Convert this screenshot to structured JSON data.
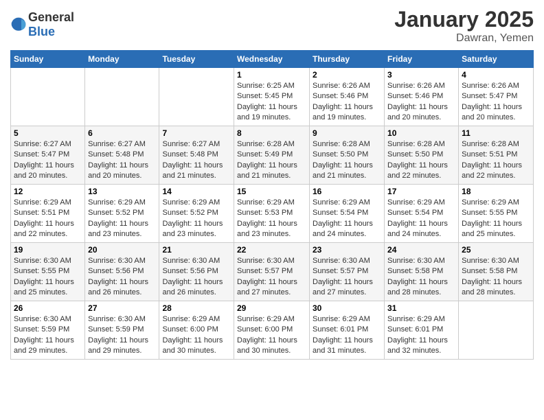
{
  "header": {
    "logo_general": "General",
    "logo_blue": "Blue",
    "month_title": "January 2025",
    "location": "Dawran, Yemen"
  },
  "days_of_week": [
    "Sunday",
    "Monday",
    "Tuesday",
    "Wednesday",
    "Thursday",
    "Friday",
    "Saturday"
  ],
  "weeks": [
    [
      {
        "num": "",
        "info": ""
      },
      {
        "num": "",
        "info": ""
      },
      {
        "num": "",
        "info": ""
      },
      {
        "num": "1",
        "info": "Sunrise: 6:25 AM\nSunset: 5:45 PM\nDaylight: 11 hours and 19 minutes."
      },
      {
        "num": "2",
        "info": "Sunrise: 6:26 AM\nSunset: 5:46 PM\nDaylight: 11 hours and 19 minutes."
      },
      {
        "num": "3",
        "info": "Sunrise: 6:26 AM\nSunset: 5:46 PM\nDaylight: 11 hours and 20 minutes."
      },
      {
        "num": "4",
        "info": "Sunrise: 6:26 AM\nSunset: 5:47 PM\nDaylight: 11 hours and 20 minutes."
      }
    ],
    [
      {
        "num": "5",
        "info": "Sunrise: 6:27 AM\nSunset: 5:47 PM\nDaylight: 11 hours and 20 minutes."
      },
      {
        "num": "6",
        "info": "Sunrise: 6:27 AM\nSunset: 5:48 PM\nDaylight: 11 hours and 20 minutes."
      },
      {
        "num": "7",
        "info": "Sunrise: 6:27 AM\nSunset: 5:48 PM\nDaylight: 11 hours and 21 minutes."
      },
      {
        "num": "8",
        "info": "Sunrise: 6:28 AM\nSunset: 5:49 PM\nDaylight: 11 hours and 21 minutes."
      },
      {
        "num": "9",
        "info": "Sunrise: 6:28 AM\nSunset: 5:50 PM\nDaylight: 11 hours and 21 minutes."
      },
      {
        "num": "10",
        "info": "Sunrise: 6:28 AM\nSunset: 5:50 PM\nDaylight: 11 hours and 22 minutes."
      },
      {
        "num": "11",
        "info": "Sunrise: 6:28 AM\nSunset: 5:51 PM\nDaylight: 11 hours and 22 minutes."
      }
    ],
    [
      {
        "num": "12",
        "info": "Sunrise: 6:29 AM\nSunset: 5:51 PM\nDaylight: 11 hours and 22 minutes."
      },
      {
        "num": "13",
        "info": "Sunrise: 6:29 AM\nSunset: 5:52 PM\nDaylight: 11 hours and 23 minutes."
      },
      {
        "num": "14",
        "info": "Sunrise: 6:29 AM\nSunset: 5:52 PM\nDaylight: 11 hours and 23 minutes."
      },
      {
        "num": "15",
        "info": "Sunrise: 6:29 AM\nSunset: 5:53 PM\nDaylight: 11 hours and 23 minutes."
      },
      {
        "num": "16",
        "info": "Sunrise: 6:29 AM\nSunset: 5:54 PM\nDaylight: 11 hours and 24 minutes."
      },
      {
        "num": "17",
        "info": "Sunrise: 6:29 AM\nSunset: 5:54 PM\nDaylight: 11 hours and 24 minutes."
      },
      {
        "num": "18",
        "info": "Sunrise: 6:29 AM\nSunset: 5:55 PM\nDaylight: 11 hours and 25 minutes."
      }
    ],
    [
      {
        "num": "19",
        "info": "Sunrise: 6:30 AM\nSunset: 5:55 PM\nDaylight: 11 hours and 25 minutes."
      },
      {
        "num": "20",
        "info": "Sunrise: 6:30 AM\nSunset: 5:56 PM\nDaylight: 11 hours and 26 minutes."
      },
      {
        "num": "21",
        "info": "Sunrise: 6:30 AM\nSunset: 5:56 PM\nDaylight: 11 hours and 26 minutes."
      },
      {
        "num": "22",
        "info": "Sunrise: 6:30 AM\nSunset: 5:57 PM\nDaylight: 11 hours and 27 minutes."
      },
      {
        "num": "23",
        "info": "Sunrise: 6:30 AM\nSunset: 5:57 PM\nDaylight: 11 hours and 27 minutes."
      },
      {
        "num": "24",
        "info": "Sunrise: 6:30 AM\nSunset: 5:58 PM\nDaylight: 11 hours and 28 minutes."
      },
      {
        "num": "25",
        "info": "Sunrise: 6:30 AM\nSunset: 5:58 PM\nDaylight: 11 hours and 28 minutes."
      }
    ],
    [
      {
        "num": "26",
        "info": "Sunrise: 6:30 AM\nSunset: 5:59 PM\nDaylight: 11 hours and 29 minutes."
      },
      {
        "num": "27",
        "info": "Sunrise: 6:30 AM\nSunset: 5:59 PM\nDaylight: 11 hours and 29 minutes."
      },
      {
        "num": "28",
        "info": "Sunrise: 6:29 AM\nSunset: 6:00 PM\nDaylight: 11 hours and 30 minutes."
      },
      {
        "num": "29",
        "info": "Sunrise: 6:29 AM\nSunset: 6:00 PM\nDaylight: 11 hours and 30 minutes."
      },
      {
        "num": "30",
        "info": "Sunrise: 6:29 AM\nSunset: 6:01 PM\nDaylight: 11 hours and 31 minutes."
      },
      {
        "num": "31",
        "info": "Sunrise: 6:29 AM\nSunset: 6:01 PM\nDaylight: 11 hours and 32 minutes."
      },
      {
        "num": "",
        "info": ""
      }
    ]
  ]
}
